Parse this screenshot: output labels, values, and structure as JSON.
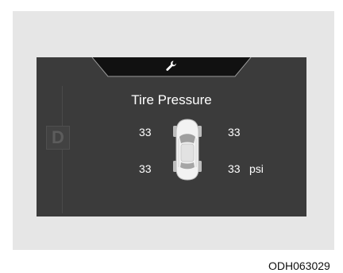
{
  "display": {
    "gear": "D",
    "title": "Tire Pressure",
    "tires": {
      "front_left": "33",
      "front_right": "33",
      "rear_left": "33",
      "rear_right": "33"
    },
    "unit": "psi",
    "top_icon": "wrench-icon"
  },
  "figure_code": "ODH063029",
  "colors": {
    "cluster_bg": "#3b3b3b",
    "top_band": "#111111",
    "frame_bg": "#e6e6e6",
    "text": "#ffffff"
  }
}
